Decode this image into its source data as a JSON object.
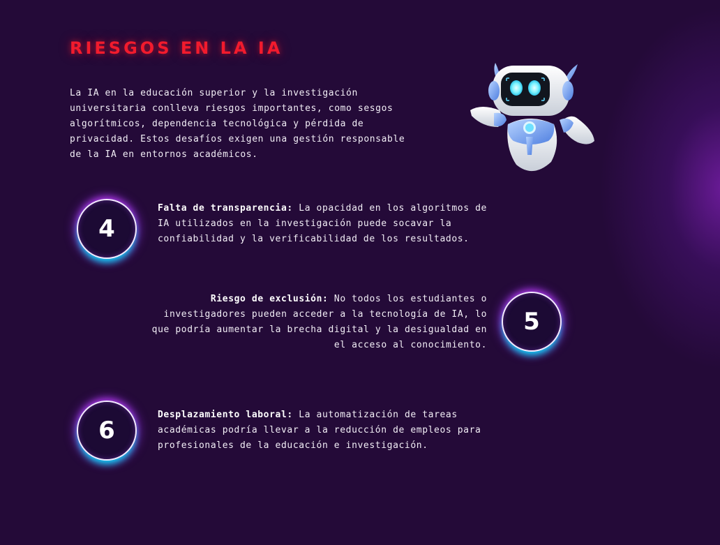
{
  "header": {
    "title": "RIESGOS EN LA IA"
  },
  "intro": {
    "text": "La IA en la educación superior y la investigación universitaria conlleva riesgos importantes, como sesgos algorítmicos, dependencia tecnológica y pérdida de privacidad. Estos desafíos exigen una gestión responsable de la IA en entornos académicos."
  },
  "illustration": {
    "icon": "robot-icon"
  },
  "risks": [
    {
      "number": "4",
      "title": "Falta de transparencia:",
      "body": "La opacidad en los algoritmos de IA utilizados en la investigación puede socavar la confiabilidad y la verificabilidad de los resultados."
    },
    {
      "number": "5",
      "title": "Riesgo de exclusión:",
      "body": "No todos los estudiantes o investigadores pueden acceder a la tecnología de IA, lo que podría aumentar la brecha digital y la desigualdad en el acceso al conocimiento."
    },
    {
      "number": "6",
      "title": "Desplazamiento laboral:",
      "body": "La automatización de tareas académicas podría llevar a la reducción de empleos para profesionales de la educación e investigación."
    }
  ],
  "colors": {
    "background": "#240a38",
    "title": "#f21b2d",
    "ring_cyan": "#00e6ff",
    "ring_magenta": "#cd3cff"
  }
}
